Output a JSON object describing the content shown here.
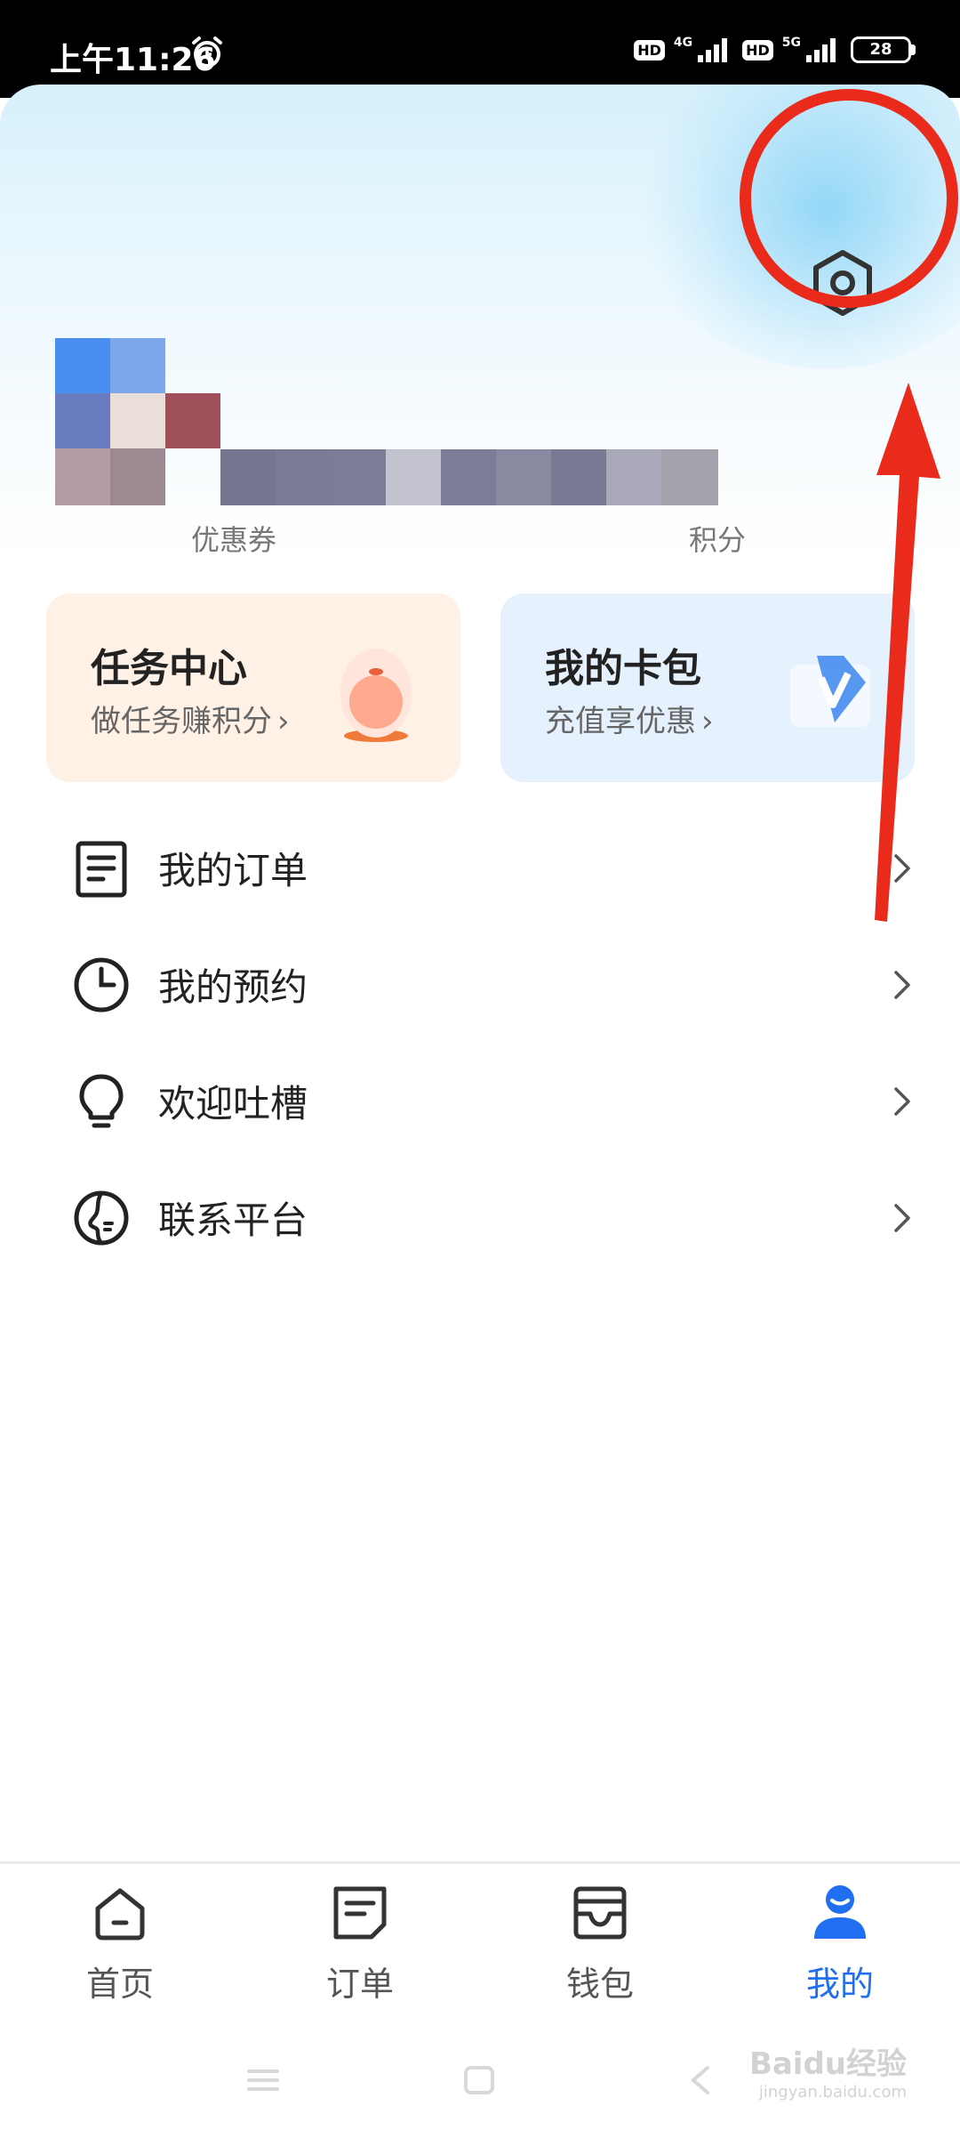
{
  "status_bar": {
    "time": "上午11:26",
    "hd1": "HD",
    "net1": "4G",
    "hd2": "HD",
    "net2": "5G",
    "battery": "28"
  },
  "profile": {
    "stats": [
      {
        "label": "优惠券"
      },
      {
        "label": "积分"
      }
    ]
  },
  "cards": {
    "task": {
      "title": "任务中心",
      "subtitle": "做任务赚积分"
    },
    "wallet": {
      "title": "我的卡包",
      "subtitle": "充值享优惠"
    }
  },
  "menu": {
    "items": [
      {
        "label": "我的订单",
        "icon": "document-icon"
      },
      {
        "label": "我的预约",
        "icon": "clock-icon"
      },
      {
        "label": "欢迎吐槽",
        "icon": "lightbulb-icon"
      },
      {
        "label": "联系平台",
        "icon": "contact-icon"
      }
    ]
  },
  "tabbar": {
    "items": [
      {
        "label": "首页",
        "icon": "home-icon",
        "active": false
      },
      {
        "label": "订单",
        "icon": "orders-icon",
        "active": false
      },
      {
        "label": "钱包",
        "icon": "wallet-icon",
        "active": false
      },
      {
        "label": "我的",
        "icon": "person-icon",
        "active": true
      }
    ]
  },
  "watermark": {
    "text": "Baidu经验",
    "url": "jingyan.baidu.com"
  },
  "colors": {
    "accent": "#1f6ff0",
    "highlight": "#ea2a1a",
    "task_card_bg": "#fff1e6",
    "wallet_card_bg": "#e6f1fe"
  }
}
